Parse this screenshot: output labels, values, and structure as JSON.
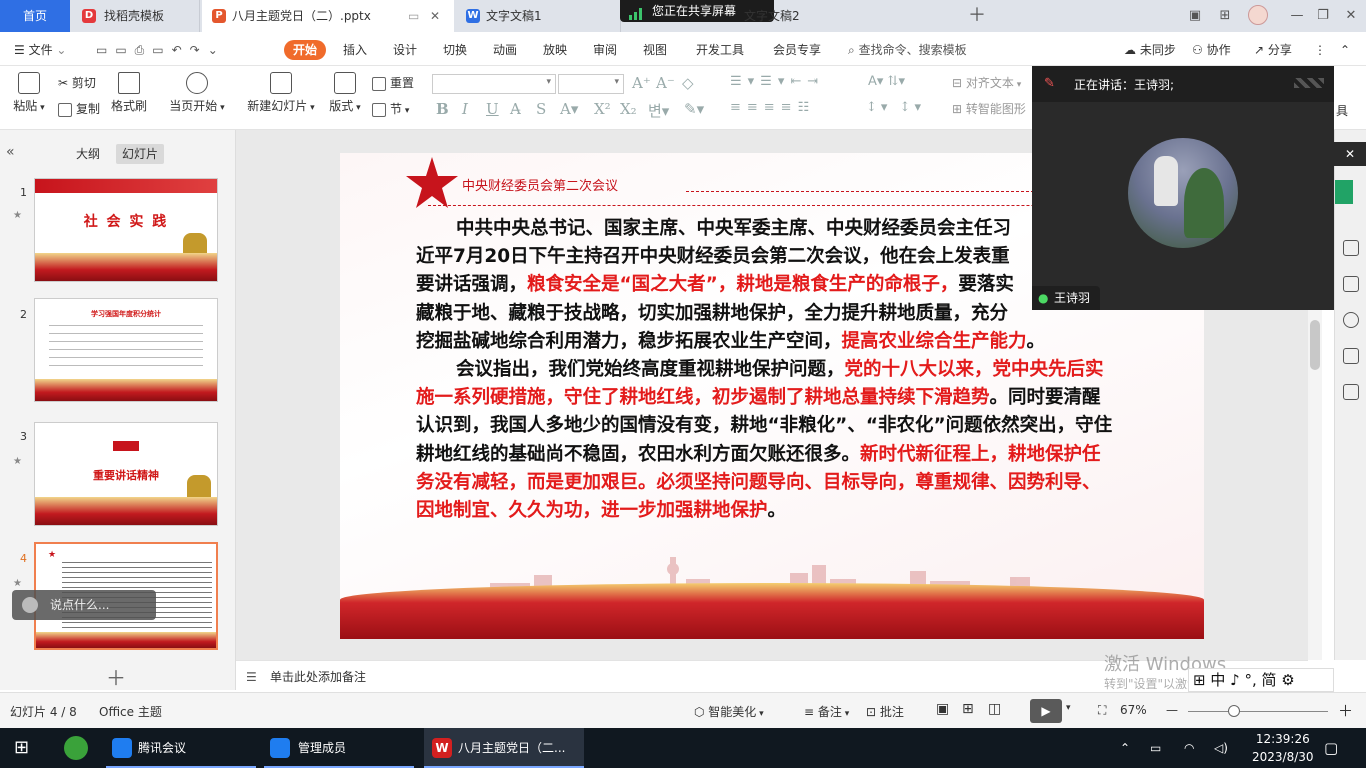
{
  "tabs": {
    "home": "首页",
    "t1": "找稻壳模板",
    "t2": "八月主题党日（二）.pptx",
    "t3": "文字文稿1",
    "t4": "文字文稿2",
    "share": "您正在共享屏幕"
  },
  "menu": {
    "file": "文件",
    "items": [
      "开始",
      "插入",
      "设计",
      "切换",
      "动画",
      "放映",
      "审阅",
      "视图",
      "开发工具",
      "会员专享"
    ],
    "search": "查找命令、搜索模板",
    "unsync": "未同步",
    "coop": "协作",
    "share": "分享"
  },
  "ribbon": {
    "paste": "粘贴",
    "cut": "剪切",
    "copy": "复制",
    "format_painter": "格式刷",
    "from_start": "当页开始",
    "new_slide": "新建幻灯片",
    "layout": "版式",
    "reset": "重置",
    "section": "节",
    "align_text": "对齐文本",
    "to_smartart": "转智能图形",
    "tools": "具"
  },
  "left_panel": {
    "outline": "大纲",
    "slides": "幻灯片",
    "thumbs": [
      {
        "num": "1",
        "title": "社 会 实 践"
      },
      {
        "num": "2",
        "title": "学习强国年度积分统计"
      },
      {
        "num": "3",
        "title": "重要讲话精神"
      },
      {
        "num": "4",
        "title": ""
      }
    ],
    "say_something": "说点什么..."
  },
  "slide": {
    "header": "中央财经委员会第二次会议",
    "p1_a": "中共中央总书记、国家主席、中央军委主席、中央财经委员会主任习",
    "p1_b": "近平7月20日下午主持召开中央财经委员会第二次会议，他在会上发表重",
    "p1_c": "要讲话强调，",
    "p1_red1": "粮食安全是“国之大者”，耕地是粮食生产的命根子，",
    "p1_d": "要落实",
    "p1_e": "藏粮于地、藏粮于技战略，切实加强耕地保护，全力提升耕地质量，充分",
    "p1_f": "挖掘盐碱地综合利用潜力，稳步拓展农业生产空间，",
    "p1_red2": "提高农业综合生产能力",
    "p1_end": "。",
    "p2_a": "会议指出，我们党始终高度重视耕地保护问题，",
    "p2_red1": "党的十八大以来，党中央先后实施一系列硬措施，守住了耕地红线，初步遏制了耕地总量持续下滑趋势",
    "p2_b": "。同时要清醒认识到，我国人多地少的国情没有变，耕地“非粮化”、“非农化”问题依然突出，守住耕地红线的基础尚不稳固，农田水利方面欠账还很多。",
    "p2_red2": "新时代新征程上，耕地保护任务没有减轻，而是更加艰巨。必须坚持问题导向、目标导向，尊重规律、因势利导、因地制宜、久久为功，进一步加强耕地保护",
    "p2_end": "。"
  },
  "notes": "单击此处添加备注",
  "status": {
    "slide_pos": "幻灯片 4 / 8",
    "theme": "Office 主题",
    "beautify": "智能美化",
    "notes": "备注",
    "comment": "批注",
    "zoom": "67%"
  },
  "watermark": {
    "line1": "激活 Windows",
    "line2": "转到\"设置\"以激活 Windows。"
  },
  "ime": "中 ♪ °, 简",
  "meeting": {
    "speaking": "正在讲话：王诗羽;",
    "name": "王诗羽"
  },
  "taskbar": {
    "tencent": "腾讯会议",
    "members": "管理成员",
    "wps": "八月主题党日（二...",
    "time": "12:39:26",
    "date": "2023/8/30"
  },
  "colors": {
    "accent": "#f06b2b",
    "home_tab": "#2f6fe4",
    "slide_red": "#e31b1b"
  }
}
